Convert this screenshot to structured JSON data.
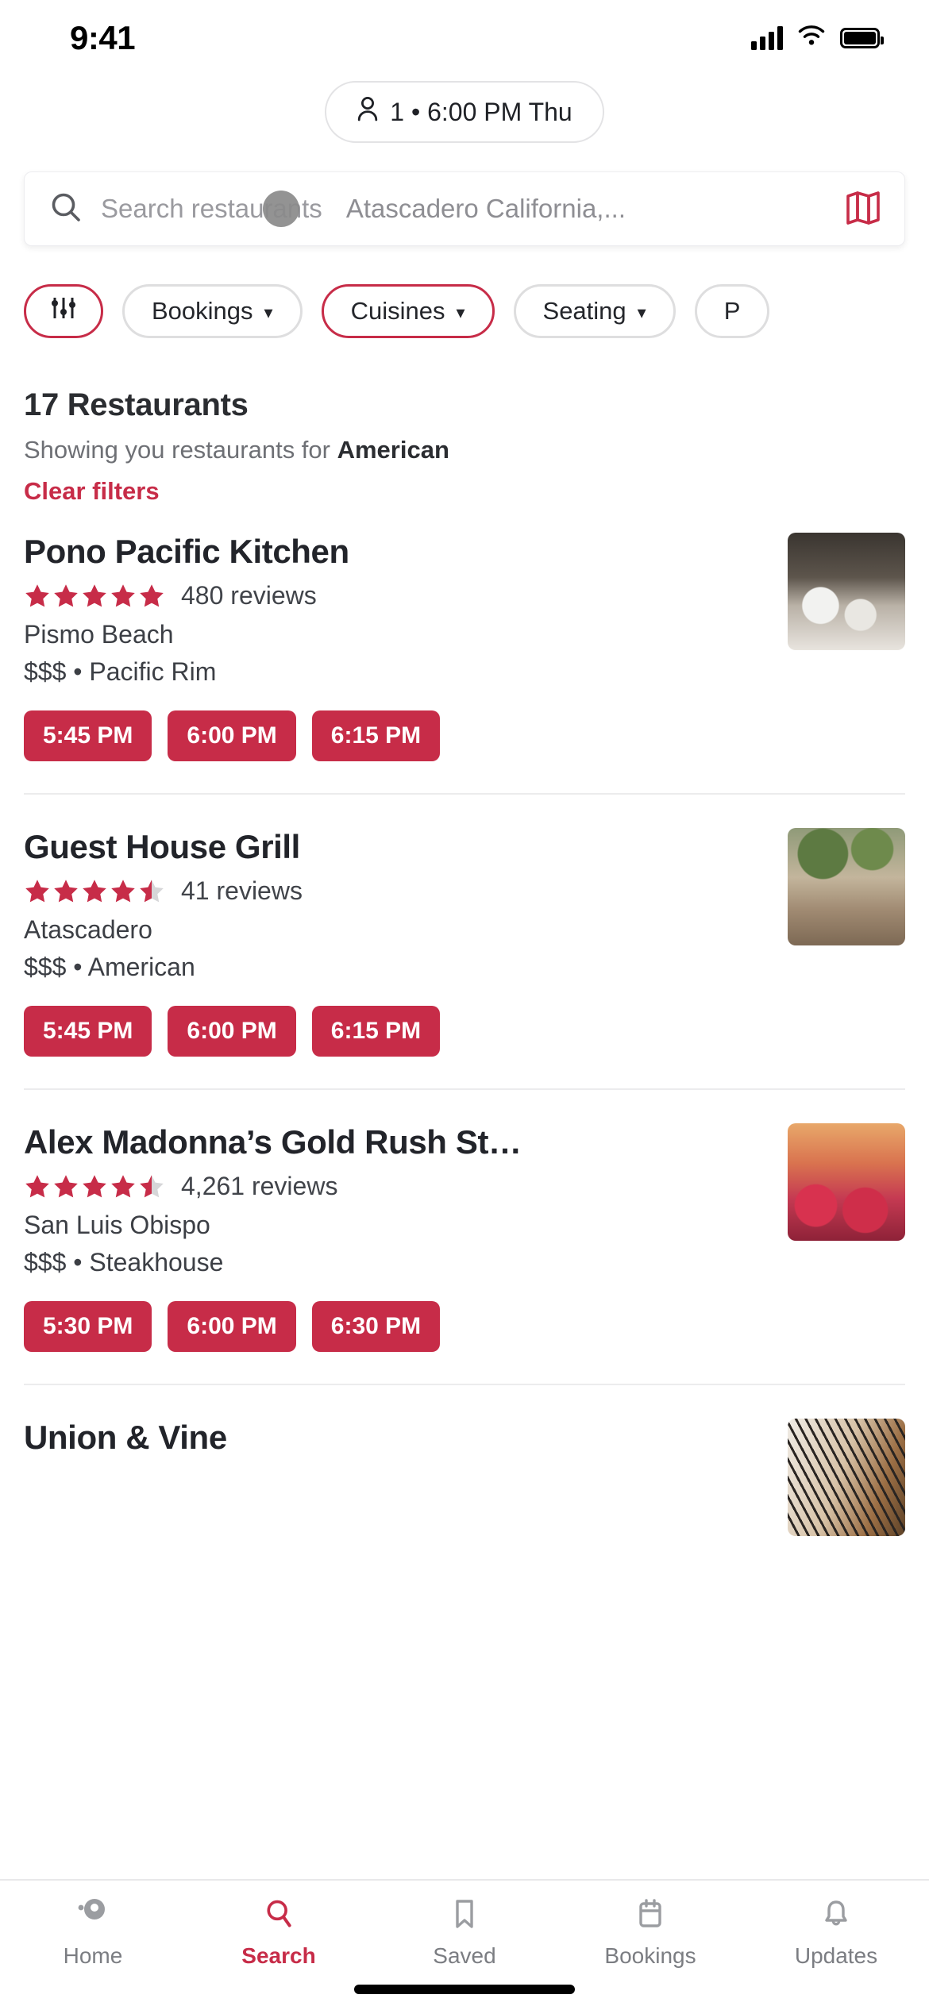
{
  "status_bar": {
    "time": "9:41",
    "signal_icon": "cellular-signal-icon",
    "wifi_icon": "wifi-icon",
    "battery_icon": "battery-icon"
  },
  "party_pill": {
    "person_icon": "person-icon",
    "label": "1 • 6:00 PM Thu"
  },
  "search": {
    "search_icon": "search-icon",
    "placeholder": "Search restaurants",
    "location": "Atascadero California,...",
    "map_icon": "map-icon",
    "touch_indicator": "touch-indicator"
  },
  "filters": {
    "chips": [
      {
        "label": "",
        "icon": "filter-sliders-icon",
        "active": true,
        "has_chevron": false
      },
      {
        "label": "Bookings",
        "icon": "",
        "active": false,
        "has_chevron": true
      },
      {
        "label": "Cuisines",
        "icon": "",
        "active": true,
        "has_chevron": true
      },
      {
        "label": "Seating",
        "icon": "",
        "active": false,
        "has_chevron": true
      },
      {
        "label": "P",
        "icon": "",
        "active": false,
        "has_chevron": false
      }
    ]
  },
  "results": {
    "count_label": "17 Restaurants",
    "subtitle_prefix": "Showing you restaurants for ",
    "subtitle_filter": "American",
    "clear_filters_label": "Clear filters"
  },
  "restaurants": [
    {
      "name": "Pono Pacific Kitchen",
      "rating": 5,
      "reviews": "480 reviews",
      "city": "Pismo Beach",
      "meta": "$$$ • Pacific Rim",
      "times": [
        "5:45 PM",
        "6:00 PM",
        "6:15 PM"
      ],
      "thumb": "ph1"
    },
    {
      "name": "Guest House Grill",
      "rating": 4.5,
      "reviews": "41 reviews",
      "city": "Atascadero",
      "meta": "$$$ • American",
      "times": [
        "5:45 PM",
        "6:00 PM",
        "6:15 PM"
      ],
      "thumb": "ph2"
    },
    {
      "name": "Alex Madonna’s Gold Rush Steak…",
      "rating": 4.5,
      "reviews": "4,261 reviews",
      "city": "San Luis Obispo",
      "meta": "$$$ • Steakhouse",
      "times": [
        "5:30 PM",
        "6:00 PM",
        "6:30 PM"
      ],
      "thumb": "ph3"
    },
    {
      "name": "Union & Vine",
      "rating": 0,
      "reviews": "",
      "city": "",
      "meta": "",
      "times": [],
      "thumb": "ph4"
    }
  ],
  "tabbar": {
    "items": [
      {
        "label": "Home",
        "icon": "home-icon",
        "active": false
      },
      {
        "label": "Search",
        "icon": "search-icon",
        "active": true
      },
      {
        "label": "Saved",
        "icon": "bookmark-icon",
        "active": false
      },
      {
        "label": "Bookings",
        "icon": "calendar-icon",
        "active": false
      },
      {
        "label": "Updates",
        "icon": "bell-icon",
        "active": false
      }
    ]
  },
  "colors": {
    "accent": "#c72c48",
    "text_primary": "#2b2d31",
    "text_secondary": "#6e7075",
    "border": "#dededf"
  }
}
